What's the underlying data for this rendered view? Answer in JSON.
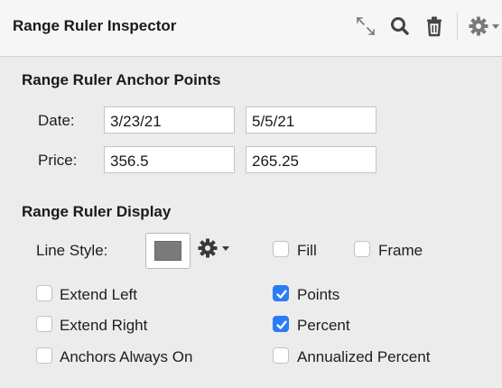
{
  "header": {
    "title": "Range Ruler Inspector",
    "icons": [
      "resize-icon",
      "search-icon",
      "trash-icon",
      "gear-icon"
    ]
  },
  "anchors": {
    "title": "Range Ruler Anchor Points",
    "date_label": "Date:",
    "date_start": "3/23/21",
    "date_end": "5/5/21",
    "price_label": "Price:",
    "price_start": "356.5",
    "price_end": "265.25"
  },
  "display": {
    "title": "Range Ruler Display",
    "line_style_label": "Line Style:",
    "line_color": "#7b7b7b",
    "fill": {
      "label": "Fill",
      "checked": false
    },
    "frame": {
      "label": "Frame",
      "checked": false
    },
    "extend_left": {
      "label": "Extend Left",
      "checked": false
    },
    "extend_right": {
      "label": "Extend Right",
      "checked": false
    },
    "anchors_always_on": {
      "label": "Anchors Always On",
      "checked": false
    },
    "points": {
      "label": "Points",
      "checked": true
    },
    "percent": {
      "label": "Percent",
      "checked": true
    },
    "annualized_percent": {
      "label": "Annualized Percent",
      "checked": false
    }
  },
  "colors": {
    "accent": "#2a7cf6",
    "panel": "#ececec",
    "header": "#f6f6f6"
  }
}
